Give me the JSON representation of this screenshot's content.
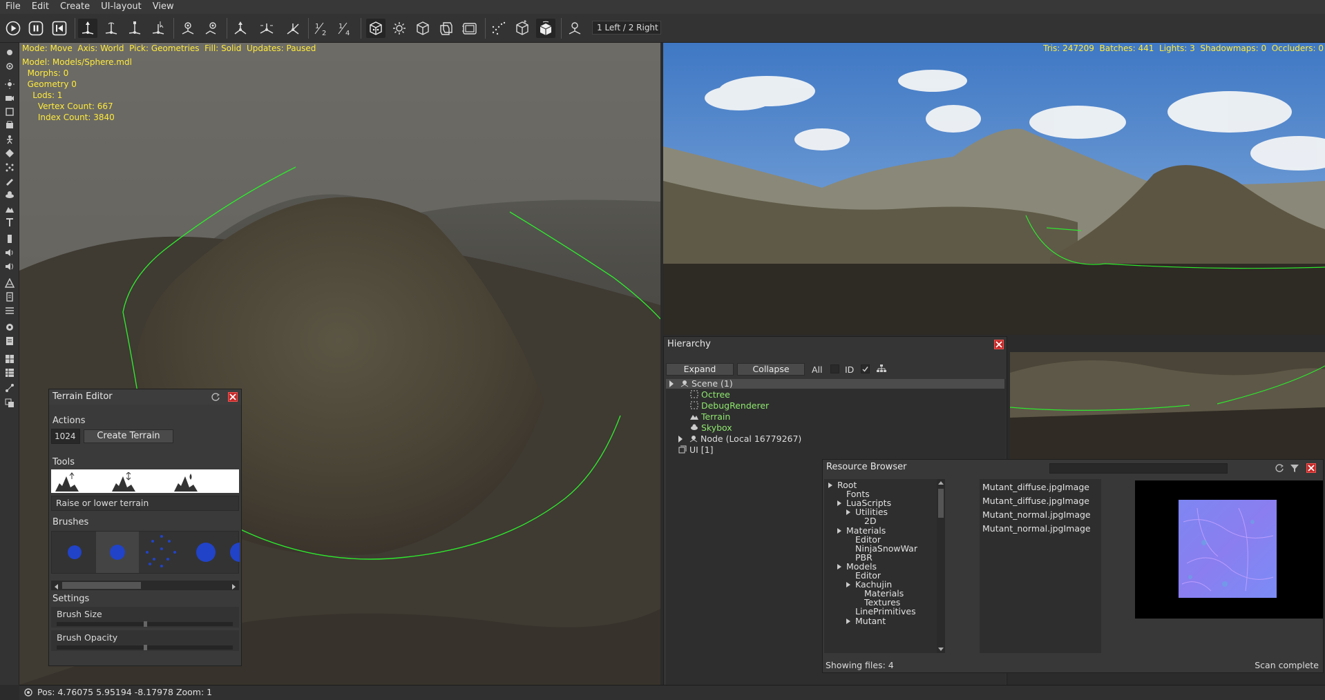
{
  "menu": [
    "File",
    "Edit",
    "Create",
    "UI-layout",
    "View"
  ],
  "toolbar": {
    "viewport_layout": "1 Left / 2 Right",
    "buttons": [
      "play-icon",
      "pause-icon",
      "restart-icon",
      "move-tool-icon",
      "rotate-tool-icon",
      "scale-tool-icon",
      "select-tool-icon",
      "pick-node-icon",
      "pick-component-icon",
      "axis-world-icon",
      "axis-local-icon",
      "snap-icon",
      "half-snap-icon",
      "quarter-snap-icon",
      "fill-points-icon",
      "fill-wireframe-icon",
      "fill-solid-icon",
      "geometry-pick-icon",
      "light-pick-icon",
      "zone-pick-icon",
      "rigidbody-pick-icon",
      "ui-element-pick-icon",
      "camera-icon"
    ]
  },
  "main_viewport": {
    "osd_line1": "Mode: Move  Axis: World  Pick: Geometries  Fill: Solid  Updates: Paused",
    "model": "Model: Models/Sphere.mdl",
    "morphs": "  Morphs: 0",
    "geometry": "  Geometry 0",
    "lods": "    Lods: 1",
    "vertex_count": "      Vertex Count: 667",
    "index_count": "      Index Count: 3840"
  },
  "right_viewport": {
    "stats": "Tris: 247209  Batches: 441  Lights: 3  Shadowmaps: 0  Occluders: 0"
  },
  "terrain_editor": {
    "title": "Terrain Editor",
    "actions_label": "Actions",
    "size_value": "1024",
    "create_button": "Create Terrain",
    "tools_label": "Tools",
    "tool_description": "Raise or lower terrain",
    "brushes_label": "Brushes",
    "settings_label": "Settings",
    "brush_size_label": "Brush Size",
    "brush_size_value": 0.5,
    "brush_opacity_label": "Brush Opacity",
    "brush_opacity_value": 0.5
  },
  "hierarchy": {
    "title": "Hierarchy",
    "expand_button": "Expand",
    "collapse_button": "Collapse",
    "all_label": "All",
    "id_label": "ID",
    "scene": "Scene (1)",
    "children": [
      "Octree",
      "DebugRenderer",
      "Terrain",
      "Skybox"
    ],
    "node": "Node (Local 16779267)",
    "ui": "UI [1]"
  },
  "resource_browser": {
    "title": "Resource Browser",
    "search_value": "",
    "tree": [
      {
        "label": "Root",
        "depth": 0,
        "expander": true
      },
      {
        "label": "Fonts",
        "depth": 1,
        "expander": false
      },
      {
        "label": "LuaScripts",
        "depth": 1,
        "expander": true
      },
      {
        "label": "Utilities",
        "depth": 2,
        "expander": true
      },
      {
        "label": "2D",
        "depth": 3,
        "expander": false
      },
      {
        "label": "Materials",
        "depth": 1,
        "expander": true
      },
      {
        "label": "Editor",
        "depth": 2,
        "expander": false
      },
      {
        "label": "NinjaSnowWar",
        "depth": 2,
        "expander": false
      },
      {
        "label": "PBR",
        "depth": 2,
        "expander": false
      },
      {
        "label": "Models",
        "depth": 1,
        "expander": true
      },
      {
        "label": "Editor",
        "depth": 2,
        "expander": false
      },
      {
        "label": "Kachujin",
        "depth": 2,
        "expander": true
      },
      {
        "label": "Materials",
        "depth": 3,
        "expander": false
      },
      {
        "label": "Textures",
        "depth": 3,
        "expander": false
      },
      {
        "label": "LinePrimitives",
        "depth": 2,
        "expander": false
      },
      {
        "label": "Mutant",
        "depth": 2,
        "expander": true
      }
    ],
    "files": [
      "Mutant_diffuse.jpgImage",
      "Mutant_diffuse.jpgImage",
      "Mutant_normal.jpgImage",
      "Mutant_normal.jpgImage"
    ],
    "showing": "Showing files: 4",
    "status": "Scan complete"
  },
  "status_bar": {
    "position": "Pos: 4.76075  5.95194  -8.17978 Zoom: 1"
  },
  "colors": {
    "selection_outline": "#2ee82e",
    "osd_text": "#ffeb3b",
    "tree_component": "#8ee86e",
    "close_button": "#c62828"
  }
}
